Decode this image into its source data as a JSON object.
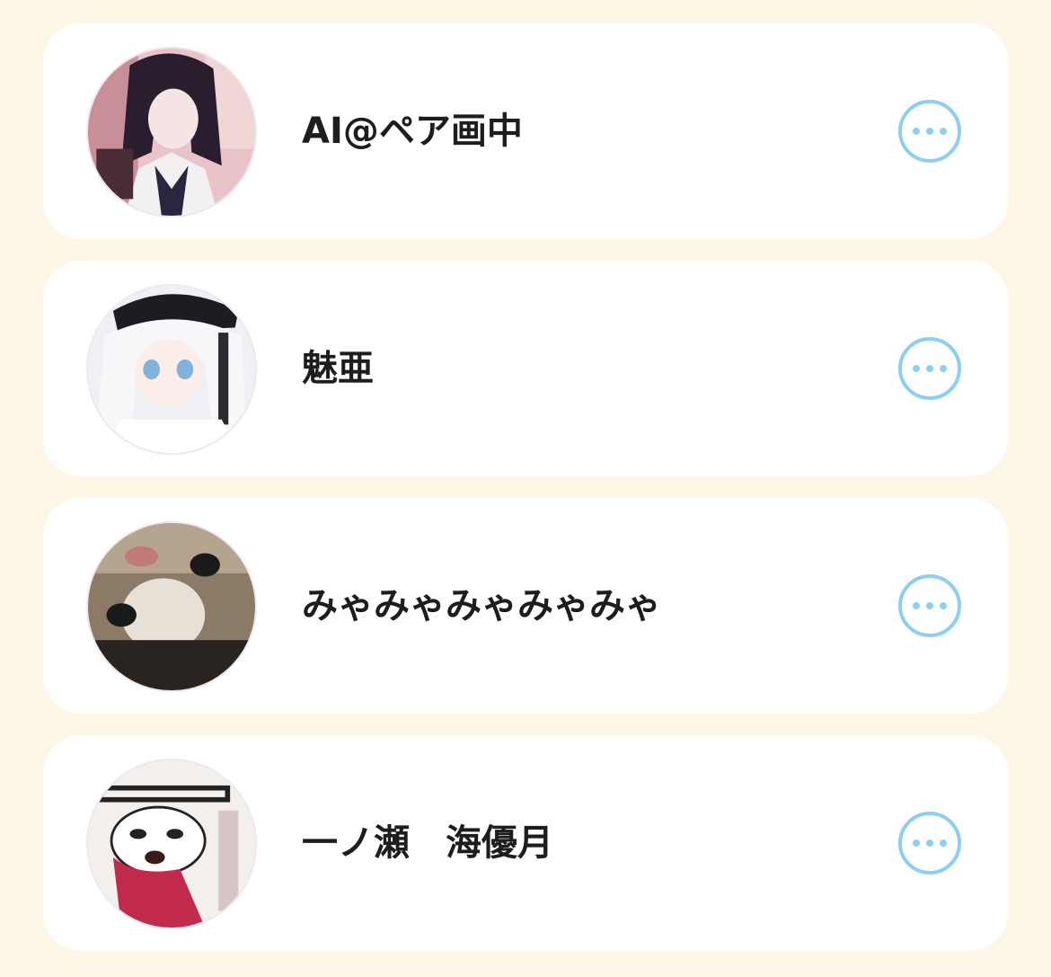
{
  "accent_color": "#8ccff0",
  "background_color": "#fdf7e8",
  "users": [
    {
      "name": "AI@ペア画中",
      "more_icon": "more-horizontal-icon"
    },
    {
      "name": "魅亜",
      "more_icon": "more-horizontal-icon"
    },
    {
      "name": "みゃみゃみゃみゃみゃ",
      "more_icon": "more-horizontal-icon"
    },
    {
      "name": "一ノ瀬　海優月",
      "more_icon": "more-horizontal-icon"
    }
  ]
}
